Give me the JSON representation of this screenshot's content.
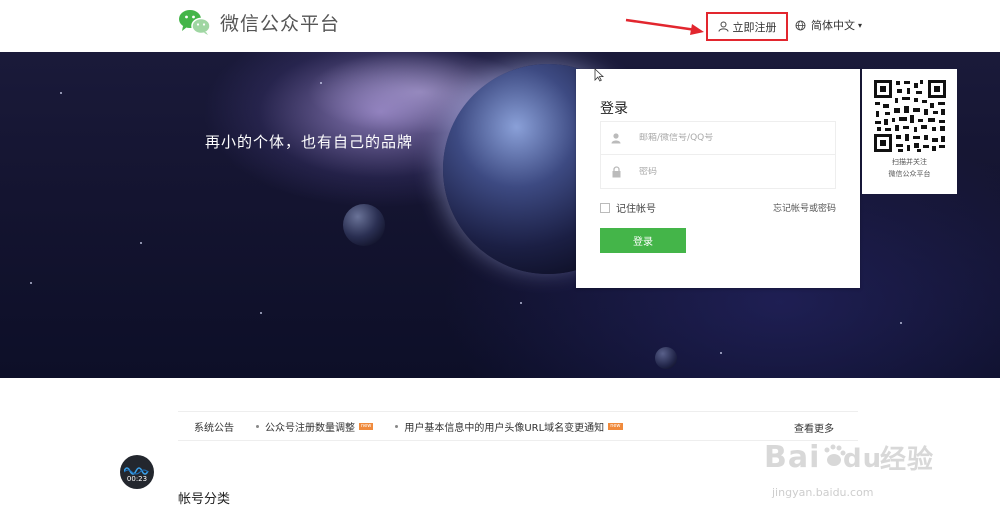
{
  "header": {
    "title": "微信公众平台",
    "register_label": "立即注册",
    "language_label": "简体中文"
  },
  "banner": {
    "slogan": "再小的个体，也有自己的品牌"
  },
  "login": {
    "title": "登录",
    "username_placeholder": "邮箱/微信号/QQ号",
    "password_placeholder": "密码",
    "remember_label": "记住帐号",
    "forgot_label": "忘记帐号或密码",
    "submit_label": "登录"
  },
  "qr": {
    "caption_line1": "扫描并关注",
    "caption_line2": "微信公众平台"
  },
  "notices": {
    "label": "系统公告",
    "items": [
      {
        "text": "公众号注册数量调整",
        "badge": "new"
      },
      {
        "text": "用户基本信息中的用户头像URL域名变更通知",
        "badge": "new"
      }
    ],
    "more_label": "查看更多"
  },
  "section": {
    "title": "帐号分类"
  },
  "video": {
    "time": "00:23"
  },
  "watermark": {
    "logo": "Baidu经验",
    "url": "jingyan.baidu.com"
  },
  "colors": {
    "primary_green": "#44b549",
    "highlight_red": "#e2262e",
    "banner_dark": "#141430"
  }
}
